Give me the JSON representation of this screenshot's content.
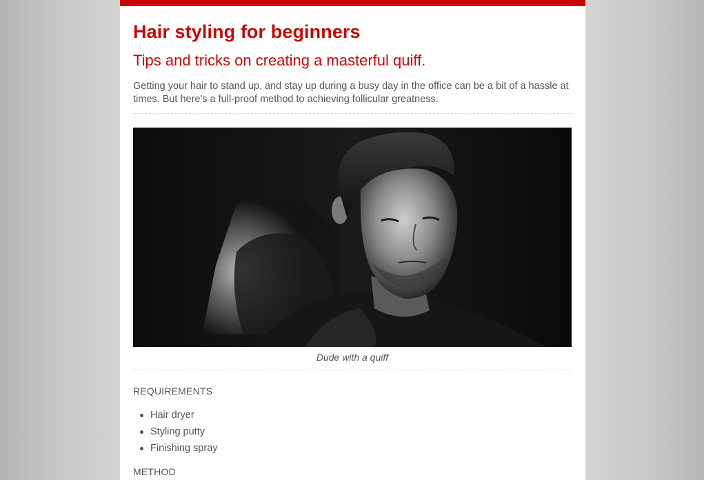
{
  "article": {
    "title": "Hair styling for beginners",
    "subtitle": "Tips and tricks on creating a masterful quiff.",
    "intro": "Getting your hair to stand up, and stay up during a busy day in the office can be a bit of a hassle at times. But here's a full-proof method to achieving follicular greatness.",
    "image": {
      "caption": "Dude with a quiff"
    },
    "requirements": {
      "heading": "REQUIREMENTS",
      "items": [
        "Hair dryer",
        "Styling putty",
        "Finishing spray"
      ]
    },
    "method": {
      "heading": "METHOD"
    }
  },
  "colors": {
    "accent": "#cc0000",
    "title": "#c40a0a",
    "body_text": "#555555"
  }
}
